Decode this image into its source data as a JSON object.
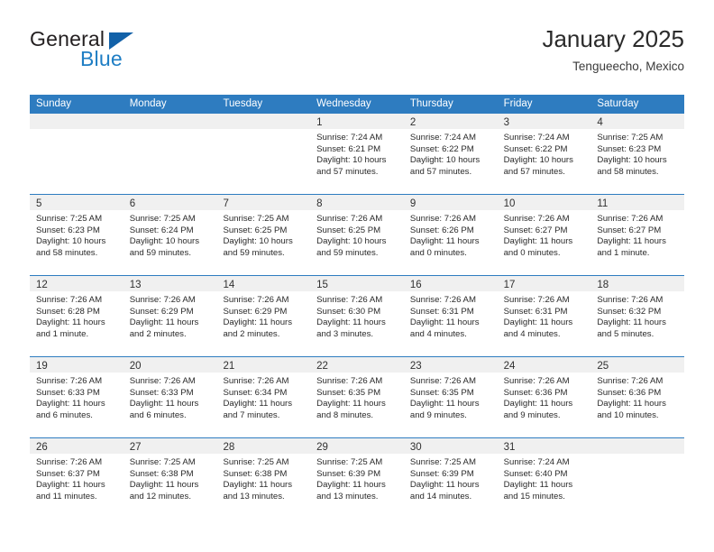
{
  "brand": {
    "word_one": "General",
    "word_two": "Blue",
    "triangle_color": "#1261a8",
    "blue_color": "#1f7ec4"
  },
  "header": {
    "title": "January 2025",
    "subtitle": "Tengueecho, Mexico",
    "accent_color": "#2e7cc0"
  },
  "weekdays": [
    "Sunday",
    "Monday",
    "Tuesday",
    "Wednesday",
    "Thursday",
    "Friday",
    "Saturday"
  ],
  "labels": {
    "sunrise_prefix": "Sunrise:",
    "sunset_prefix": "Sunset:",
    "daylight_prefix": "Daylight:"
  },
  "weeks": [
    [
      {
        "day": "",
        "empty": true
      },
      {
        "day": "",
        "empty": true
      },
      {
        "day": "",
        "empty": true
      },
      {
        "day": "1",
        "sunrise": "Sunrise: 7:24 AM",
        "sunset": "Sunset: 6:21 PM",
        "daylight_1": "Daylight: 10 hours",
        "daylight_2": "and 57 minutes."
      },
      {
        "day": "2",
        "sunrise": "Sunrise: 7:24 AM",
        "sunset": "Sunset: 6:22 PM",
        "daylight_1": "Daylight: 10 hours",
        "daylight_2": "and 57 minutes."
      },
      {
        "day": "3",
        "sunrise": "Sunrise: 7:24 AM",
        "sunset": "Sunset: 6:22 PM",
        "daylight_1": "Daylight: 10 hours",
        "daylight_2": "and 57 minutes."
      },
      {
        "day": "4",
        "sunrise": "Sunrise: 7:25 AM",
        "sunset": "Sunset: 6:23 PM",
        "daylight_1": "Daylight: 10 hours",
        "daylight_2": "and 58 minutes."
      }
    ],
    [
      {
        "day": "5",
        "sunrise": "Sunrise: 7:25 AM",
        "sunset": "Sunset: 6:23 PM",
        "daylight_1": "Daylight: 10 hours",
        "daylight_2": "and 58 minutes."
      },
      {
        "day": "6",
        "sunrise": "Sunrise: 7:25 AM",
        "sunset": "Sunset: 6:24 PM",
        "daylight_1": "Daylight: 10 hours",
        "daylight_2": "and 59 minutes."
      },
      {
        "day": "7",
        "sunrise": "Sunrise: 7:25 AM",
        "sunset": "Sunset: 6:25 PM",
        "daylight_1": "Daylight: 10 hours",
        "daylight_2": "and 59 minutes."
      },
      {
        "day": "8",
        "sunrise": "Sunrise: 7:26 AM",
        "sunset": "Sunset: 6:25 PM",
        "daylight_1": "Daylight: 10 hours",
        "daylight_2": "and 59 minutes."
      },
      {
        "day": "9",
        "sunrise": "Sunrise: 7:26 AM",
        "sunset": "Sunset: 6:26 PM",
        "daylight_1": "Daylight: 11 hours",
        "daylight_2": "and 0 minutes."
      },
      {
        "day": "10",
        "sunrise": "Sunrise: 7:26 AM",
        "sunset": "Sunset: 6:27 PM",
        "daylight_1": "Daylight: 11 hours",
        "daylight_2": "and 0 minutes."
      },
      {
        "day": "11",
        "sunrise": "Sunrise: 7:26 AM",
        "sunset": "Sunset: 6:27 PM",
        "daylight_1": "Daylight: 11 hours",
        "daylight_2": "and 1 minute."
      }
    ],
    [
      {
        "day": "12",
        "sunrise": "Sunrise: 7:26 AM",
        "sunset": "Sunset: 6:28 PM",
        "daylight_1": "Daylight: 11 hours",
        "daylight_2": "and 1 minute."
      },
      {
        "day": "13",
        "sunrise": "Sunrise: 7:26 AM",
        "sunset": "Sunset: 6:29 PM",
        "daylight_1": "Daylight: 11 hours",
        "daylight_2": "and 2 minutes."
      },
      {
        "day": "14",
        "sunrise": "Sunrise: 7:26 AM",
        "sunset": "Sunset: 6:29 PM",
        "daylight_1": "Daylight: 11 hours",
        "daylight_2": "and 2 minutes."
      },
      {
        "day": "15",
        "sunrise": "Sunrise: 7:26 AM",
        "sunset": "Sunset: 6:30 PM",
        "daylight_1": "Daylight: 11 hours",
        "daylight_2": "and 3 minutes."
      },
      {
        "day": "16",
        "sunrise": "Sunrise: 7:26 AM",
        "sunset": "Sunset: 6:31 PM",
        "daylight_1": "Daylight: 11 hours",
        "daylight_2": "and 4 minutes."
      },
      {
        "day": "17",
        "sunrise": "Sunrise: 7:26 AM",
        "sunset": "Sunset: 6:31 PM",
        "daylight_1": "Daylight: 11 hours",
        "daylight_2": "and 4 minutes."
      },
      {
        "day": "18",
        "sunrise": "Sunrise: 7:26 AM",
        "sunset": "Sunset: 6:32 PM",
        "daylight_1": "Daylight: 11 hours",
        "daylight_2": "and 5 minutes."
      }
    ],
    [
      {
        "day": "19",
        "sunrise": "Sunrise: 7:26 AM",
        "sunset": "Sunset: 6:33 PM",
        "daylight_1": "Daylight: 11 hours",
        "daylight_2": "and 6 minutes."
      },
      {
        "day": "20",
        "sunrise": "Sunrise: 7:26 AM",
        "sunset": "Sunset: 6:33 PM",
        "daylight_1": "Daylight: 11 hours",
        "daylight_2": "and 6 minutes."
      },
      {
        "day": "21",
        "sunrise": "Sunrise: 7:26 AM",
        "sunset": "Sunset: 6:34 PM",
        "daylight_1": "Daylight: 11 hours",
        "daylight_2": "and 7 minutes."
      },
      {
        "day": "22",
        "sunrise": "Sunrise: 7:26 AM",
        "sunset": "Sunset: 6:35 PM",
        "daylight_1": "Daylight: 11 hours",
        "daylight_2": "and 8 minutes."
      },
      {
        "day": "23",
        "sunrise": "Sunrise: 7:26 AM",
        "sunset": "Sunset: 6:35 PM",
        "daylight_1": "Daylight: 11 hours",
        "daylight_2": "and 9 minutes."
      },
      {
        "day": "24",
        "sunrise": "Sunrise: 7:26 AM",
        "sunset": "Sunset: 6:36 PM",
        "daylight_1": "Daylight: 11 hours",
        "daylight_2": "and 9 minutes."
      },
      {
        "day": "25",
        "sunrise": "Sunrise: 7:26 AM",
        "sunset": "Sunset: 6:36 PM",
        "daylight_1": "Daylight: 11 hours",
        "daylight_2": "and 10 minutes."
      }
    ],
    [
      {
        "day": "26",
        "sunrise": "Sunrise: 7:26 AM",
        "sunset": "Sunset: 6:37 PM",
        "daylight_1": "Daylight: 11 hours",
        "daylight_2": "and 11 minutes."
      },
      {
        "day": "27",
        "sunrise": "Sunrise: 7:25 AM",
        "sunset": "Sunset: 6:38 PM",
        "daylight_1": "Daylight: 11 hours",
        "daylight_2": "and 12 minutes."
      },
      {
        "day": "28",
        "sunrise": "Sunrise: 7:25 AM",
        "sunset": "Sunset: 6:38 PM",
        "daylight_1": "Daylight: 11 hours",
        "daylight_2": "and 13 minutes."
      },
      {
        "day": "29",
        "sunrise": "Sunrise: 7:25 AM",
        "sunset": "Sunset: 6:39 PM",
        "daylight_1": "Daylight: 11 hours",
        "daylight_2": "and 13 minutes."
      },
      {
        "day": "30",
        "sunrise": "Sunrise: 7:25 AM",
        "sunset": "Sunset: 6:39 PM",
        "daylight_1": "Daylight: 11 hours",
        "daylight_2": "and 14 minutes."
      },
      {
        "day": "31",
        "sunrise": "Sunrise: 7:24 AM",
        "sunset": "Sunset: 6:40 PM",
        "daylight_1": "Daylight: 11 hours",
        "daylight_2": "and 15 minutes."
      },
      {
        "day": "",
        "empty": true
      }
    ]
  ]
}
